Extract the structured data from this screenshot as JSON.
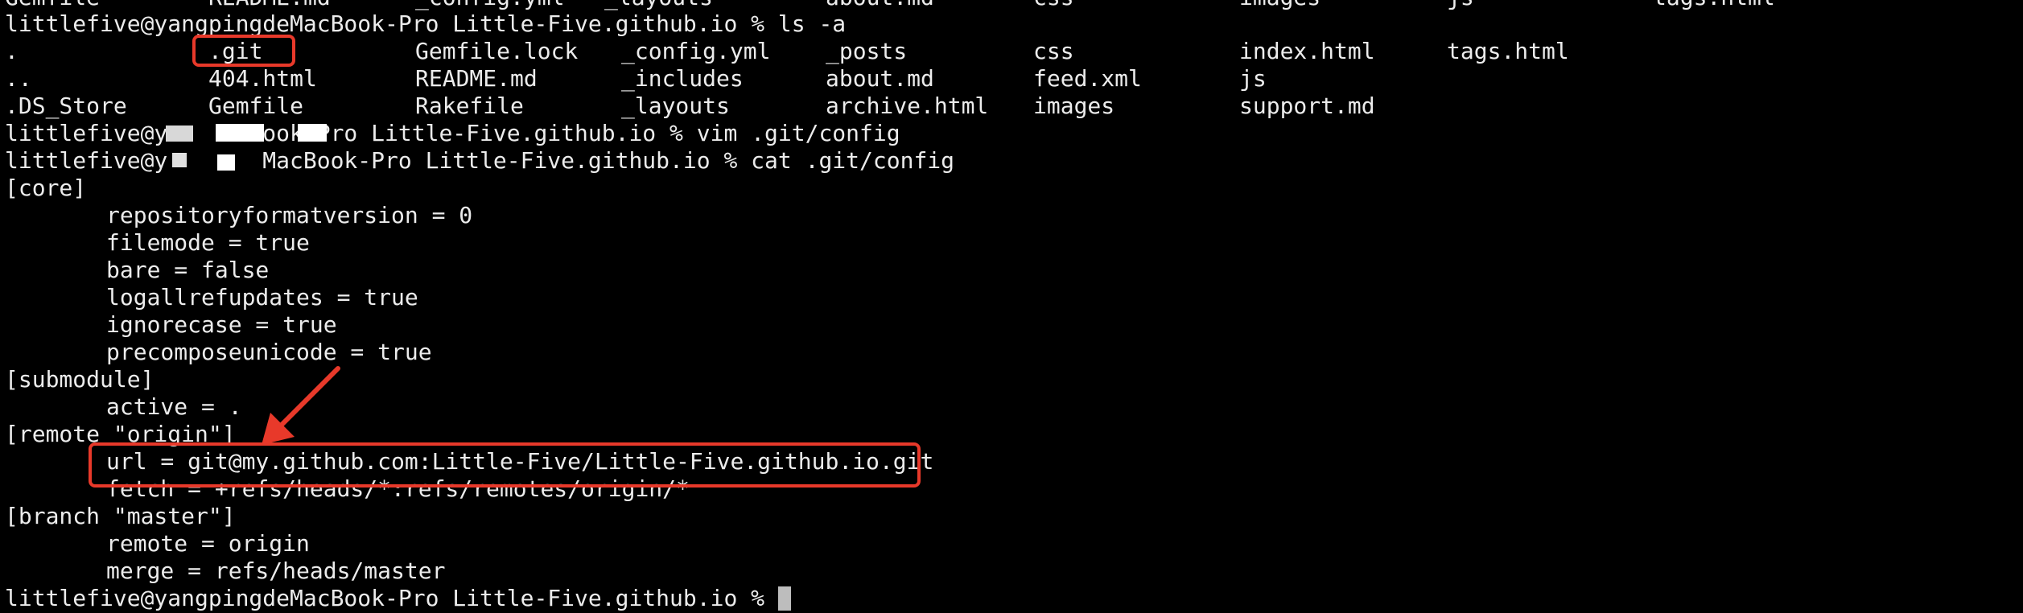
{
  "terminal": {
    "prompt": "littlefive@yangpingdeMacBook-Pro Little-Five.github.io % ",
    "cmd_ls": "ls -a",
    "truncated_top": [
      "Gemfile",
      "README.md",
      "_config.yml",
      "_layouts",
      "about.md",
      "css",
      "images",
      "js",
      "tags.html"
    ],
    "ls_rows": [
      [
        ".",
        ".git",
        "Gemfile.lock",
        "_config.yml",
        "_posts",
        "css",
        "index.html",
        "tags.html"
      ],
      [
        "..",
        "404.html",
        "README.md",
        "_includes",
        "about.md",
        "feed.xml",
        "js",
        ""
      ],
      [
        ".DS_Store",
        "Gemfile",
        "Rakefile",
        "_layouts",
        "archive.html",
        "images",
        "support.md",
        ""
      ]
    ],
    "vim_line": "littlefive@y       ook-Pro Little-Five.github.io % vim .git/config",
    "cat_line": "littlefive@y       MacBook-Pro Little-Five.github.io % cat .git/config",
    "config": [
      {
        "text": "[core]",
        "indent": false
      },
      {
        "text": "repositoryformatversion = 0",
        "indent": true
      },
      {
        "text": "filemode = true",
        "indent": true
      },
      {
        "text": "bare = false",
        "indent": true
      },
      {
        "text": "logallrefupdates = true",
        "indent": true
      },
      {
        "text": "ignorecase = true",
        "indent": true
      },
      {
        "text": "precomposeunicode = true",
        "indent": true
      },
      {
        "text": "[submodule]",
        "indent": false
      },
      {
        "text": "active = .",
        "indent": true
      },
      {
        "text": "[remote \"origin\"]",
        "indent": false
      },
      {
        "text": "url = git@my.github.com:Little-Five/Little-Five.github.io.git",
        "indent": true
      },
      {
        "text": "fetch = +refs/heads/*:refs/remotes/origin/*",
        "indent": true
      },
      {
        "text": "[branch \"master\"]",
        "indent": false
      },
      {
        "text": "remote = origin",
        "indent": true
      },
      {
        "text": "merge = refs/heads/master",
        "indent": true
      }
    ],
    "final_prompt": "littlefive@yangpingdeMacBook-Pro Little-Five.github.io % "
  },
  "annotations": {
    "highlight_color": "#e8392a"
  }
}
